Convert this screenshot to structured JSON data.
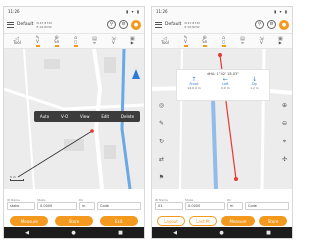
{
  "left": {
    "status": {
      "time": "11:26",
      "icons": "▮ ▾ ▮"
    },
    "header": {
      "title": "Default",
      "coords_line1": "N 47.8732",
      "coords_line2": "E 16.8232"
    },
    "tools": [
      {
        "label": "Tool",
        "icon": "ruler-icon"
      },
      {
        "label": "V",
        "icon": "dropdown-icon"
      },
      {
        "label": "Sn",
        "icon": "snap-icon"
      },
      {
        "label": "◻",
        "icon": "square-icon"
      },
      {
        "label": "≡",
        "icon": "layers-icon"
      },
      {
        "label": "V",
        "icon": "chevron-icon"
      },
      {
        "label": "▶",
        "icon": "play-icon"
      }
    ],
    "popup": [
      "Auto",
      "V-O",
      "View",
      "Edit",
      "Delete"
    ],
    "scale": "5 m",
    "form": {
      "field1_label": "ID Name",
      "field1_value": "stake",
      "field2_label": "Stake",
      "field2_value": "0.0000",
      "field3_label": "Dir",
      "field3_value": "m",
      "field4_value": "Code"
    },
    "actions": [
      "Measure",
      "Store",
      "Exit"
    ],
    "navbar": [
      "◀",
      "●",
      "■"
    ]
  },
  "right": {
    "status": {
      "time": "11:26",
      "icons": "▮ ▾ ▮"
    },
    "header": {
      "title": "Default",
      "coords_line1": "N 47.8732",
      "coords_line2": "E 16.8232"
    },
    "tools": [
      {
        "label": "Tool",
        "icon": "ruler-icon"
      },
      {
        "label": "V",
        "icon": "dropdown-icon"
      },
      {
        "label": "Sn",
        "icon": "snap-icon"
      },
      {
        "label": "◻",
        "icon": "square-icon"
      },
      {
        "label": "≡",
        "icon": "layers-icon"
      },
      {
        "label": "V",
        "icon": "chevron-icon"
      },
      {
        "label": "▶",
        "icon": "play-icon"
      }
    ],
    "nav_panel": {
      "title": "dHA: 1°42' 18.03\"",
      "buttons": [
        {
          "arrow": "↑",
          "label": "Front",
          "dist": "14.0.4 m"
        },
        {
          "arrow": "←",
          "label": "Left",
          "dist": "0.0 m"
        },
        {
          "arrow": "↓",
          "label": "Dp",
          "dist": "1.2 m"
        }
      ]
    },
    "form": {
      "field1_label": "ID Name",
      "field1_value": "01",
      "field2_label": "Stake",
      "field2_value": "0.0000",
      "field3_label": "Dir",
      "field3_value": "m",
      "field4_value": "Code"
    },
    "actions": [
      "Layout",
      "Last Pt",
      "Measure",
      "Store"
    ],
    "navbar": [
      "◀",
      "●",
      "■"
    ]
  },
  "colors": {
    "accent": "#f39a1e",
    "nav_blue": "#2e7bd6",
    "line_red": "#e53935",
    "road_blue": "#6aa8e6"
  }
}
